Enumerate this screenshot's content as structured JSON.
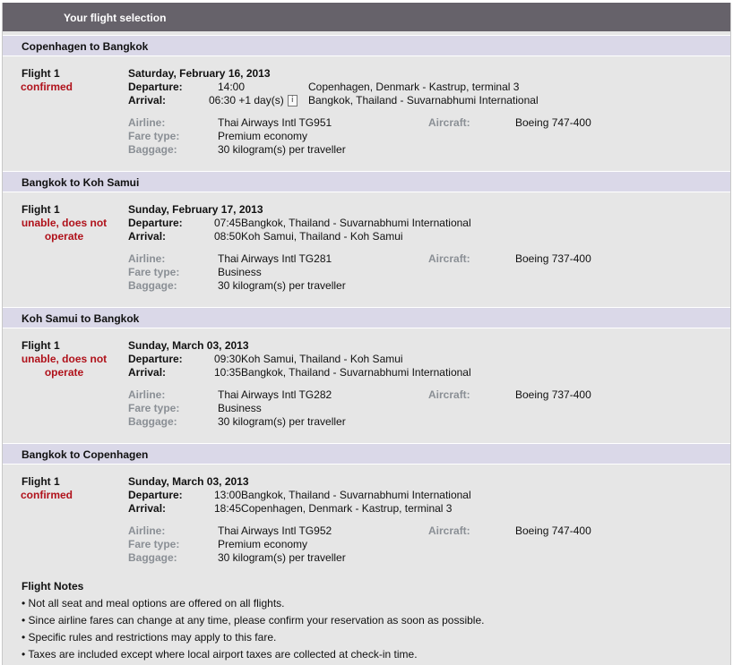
{
  "panel": {
    "title": "Your flight selection"
  },
  "labels": {
    "departure": "Departure:",
    "arrival": "Arrival:",
    "airline": "Airline:",
    "fare_type": "Fare type:",
    "baggage": "Baggage:",
    "aircraft": "Aircraft:",
    "info_icon": "i"
  },
  "segments": [
    {
      "route": "Copenhagen to Bangkok",
      "flight": "Flight 1",
      "status": "confirmed",
      "date": "Saturday, February 16, 2013",
      "departure_time": "14:00",
      "departure_place": "Copenhagen, Denmark - Kastrup, terminal 3",
      "arrival_time": "06:30 +1 day(s)",
      "arrival_place": "Bangkok, Thailand - Suvarnabhumi International",
      "airline": "Thai Airways Intl TG951",
      "fare_type": "Premium economy",
      "baggage": "30 kilogram(s) per traveller",
      "aircraft": "Boeing 747-400"
    },
    {
      "route": "Bangkok to Koh Samui",
      "flight": "Flight 1",
      "status": "unable, does not operate",
      "date": "Sunday, February 17, 2013",
      "departure": "07:45Bangkok, Thailand - Suvarnabhumi International",
      "arrival": "08:50Koh Samui, Thailand - Koh Samui",
      "airline": "Thai Airways Intl TG281",
      "fare_type": "Business",
      "baggage": "30 kilogram(s) per traveller",
      "aircraft": "Boeing 737-400"
    },
    {
      "route": "Koh Samui to Bangkok",
      "flight": "Flight 1",
      "status": "unable, does not operate",
      "date": "Sunday, March 03, 2013",
      "departure": "09:30Koh Samui, Thailand - Koh Samui",
      "arrival": "10:35Bangkok, Thailand - Suvarnabhumi International",
      "airline": "Thai Airways Intl TG282",
      "fare_type": "Business",
      "baggage": "30 kilogram(s) per traveller",
      "aircraft": "Boeing 737-400"
    },
    {
      "route": "Bangkok to Copenhagen",
      "flight": "Flight 1",
      "status": "confirmed",
      "date": "Sunday, March 03, 2013",
      "departure": "13:00Bangkok, Thailand - Suvarnabhumi International",
      "arrival": "18:45Copenhagen, Denmark - Kastrup, terminal 3",
      "airline": "Thai Airways Intl TG952",
      "fare_type": "Premium economy",
      "baggage": "30 kilogram(s) per traveller",
      "aircraft": "Boeing 747-400"
    }
  ],
  "notes": {
    "title": "Flight Notes",
    "items": [
      "• Not all seat and meal options are offered on all flights.",
      "• Since airline fares can change at any time, please confirm your reservation as soon as possible.",
      "• Specific rules and restrictions may apply to this fare.",
      "• Taxes are included except where local airport taxes are collected at check-in time."
    ]
  }
}
